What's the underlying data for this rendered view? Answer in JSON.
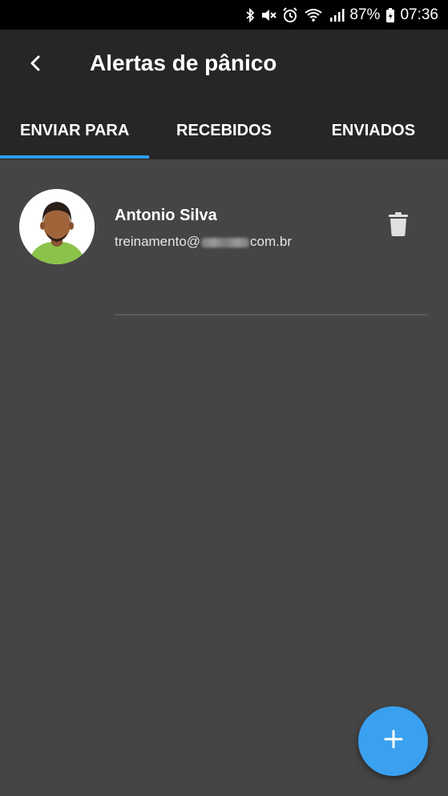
{
  "status_bar": {
    "battery_percent": "87%",
    "time": "07:36",
    "icons": [
      "bluetooth-icon",
      "mute-icon",
      "alarm-icon",
      "wifi-icon",
      "signal-icon",
      "battery-charging-icon"
    ]
  },
  "app_bar": {
    "title": "Alertas de pânico",
    "back_icon": "back-arrow-icon"
  },
  "tabs": [
    {
      "label": "ENVIAR PARA",
      "active": true
    },
    {
      "label": "RECEBIDOS",
      "active": false
    },
    {
      "label": "ENVIADOS",
      "active": false
    }
  ],
  "contacts": [
    {
      "name": "Antonio Silva",
      "email_prefix": "treinamento@",
      "email_suffix": "com.br",
      "action_icon": "trash-icon"
    }
  ],
  "fab": {
    "icon": "plus-icon"
  },
  "colors": {
    "background": "#454545",
    "app_bar": "#262626",
    "accent": "#2d9cf0",
    "fab": "#3aa0f0",
    "avatar_shirt": "#8bc34a",
    "avatar_skin": "#a0643b"
  }
}
